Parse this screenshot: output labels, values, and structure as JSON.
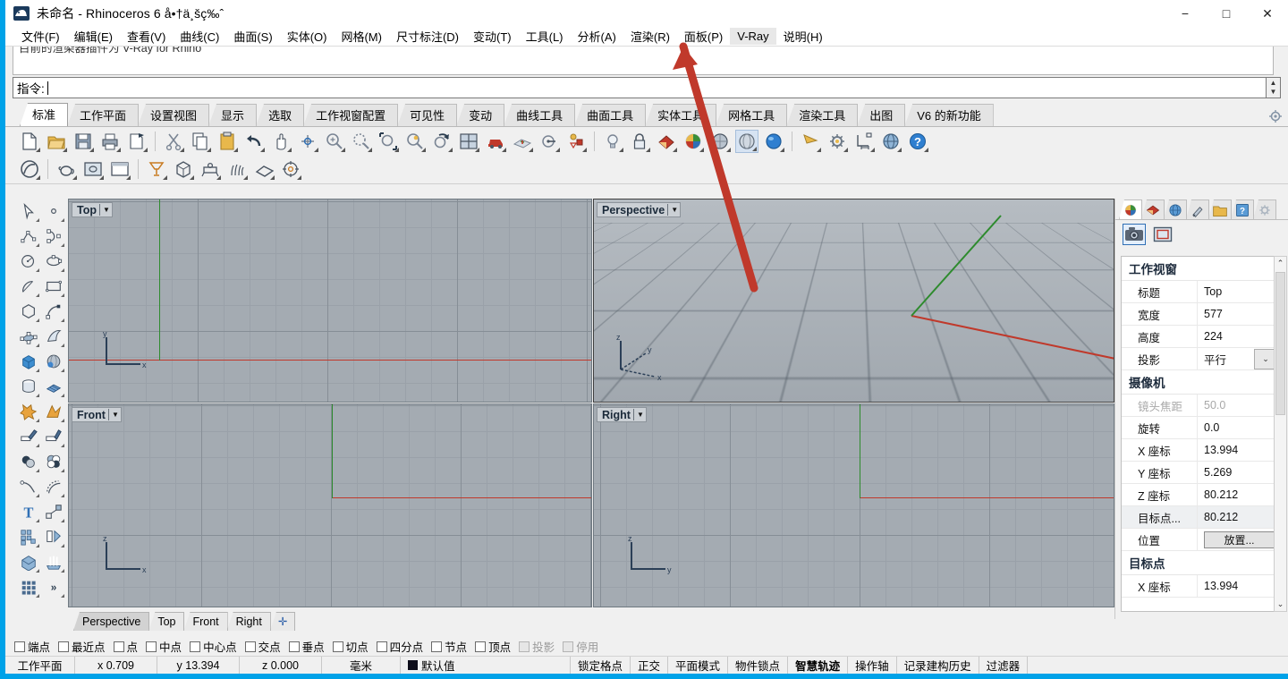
{
  "window": {
    "title": "未命名 - Rhinoceros 6 å•†ä¸šç‰ˆ",
    "app_icon": "rhino-icon",
    "minimize": "−",
    "maximize": "□",
    "close": "✕"
  },
  "menubar": {
    "items": [
      {
        "label": "文件(F)",
        "active": false
      },
      {
        "label": "编辑(E)",
        "active": false
      },
      {
        "label": "查看(V)",
        "active": false
      },
      {
        "label": "曲线(C)",
        "active": false
      },
      {
        "label": "曲面(S)",
        "active": false
      },
      {
        "label": "实体(O)",
        "active": false
      },
      {
        "label": "网格(M)",
        "active": false
      },
      {
        "label": "尺寸标注(D)",
        "active": false
      },
      {
        "label": "变动(T)",
        "active": false
      },
      {
        "label": "工具(L)",
        "active": false
      },
      {
        "label": "分析(A)",
        "active": false
      },
      {
        "label": "渲染(R)",
        "active": false
      },
      {
        "label": "面板(P)",
        "active": false
      },
      {
        "label": "V-Ray",
        "active": true
      },
      {
        "label": "说明(H)",
        "active": false
      }
    ]
  },
  "command": {
    "history_line": "目前的渲染器插件为 V-Ray for Rhino",
    "prompt_label": "指令:",
    "input_value": ""
  },
  "ribbon": {
    "tabs": [
      {
        "label": "标准",
        "selected": true
      },
      {
        "label": "工作平面",
        "selected": false
      },
      {
        "label": "设置视图",
        "selected": false
      },
      {
        "label": "显示",
        "selected": false
      },
      {
        "label": "选取",
        "selected": false
      },
      {
        "label": "工作视窗配置",
        "selected": false
      },
      {
        "label": "可见性",
        "selected": false
      },
      {
        "label": "变动",
        "selected": false
      },
      {
        "label": "曲线工具",
        "selected": false
      },
      {
        "label": "曲面工具",
        "selected": false
      },
      {
        "label": "实体工具",
        "selected": false
      },
      {
        "label": "网格工具",
        "selected": false
      },
      {
        "label": "渲染工具",
        "selected": false
      },
      {
        "label": "出图",
        "selected": false
      },
      {
        "label": "V6 的新功能",
        "selected": false
      }
    ],
    "options_icon": "gear-icon"
  },
  "toolbar_row1": [
    {
      "name": "new-file-icon"
    },
    {
      "name": "open-file-icon"
    },
    {
      "name": "save-icon"
    },
    {
      "name": "print-icon"
    },
    {
      "name": "save-as-image-icon"
    },
    {
      "sep": true
    },
    {
      "name": "cut-icon"
    },
    {
      "name": "copy-icon"
    },
    {
      "name": "paste-icon"
    },
    {
      "name": "undo-icon"
    },
    {
      "name": "pan-icon"
    },
    {
      "name": "rotate-view-icon"
    },
    {
      "name": "zoom-icon"
    },
    {
      "name": "zoom-dynamic-icon"
    },
    {
      "name": "zoom-window-icon"
    },
    {
      "name": "zoom-selected-icon"
    },
    {
      "name": "zoom-extents-icon"
    },
    {
      "name": "four-viewport-icon"
    },
    {
      "name": "render-preview-icon"
    },
    {
      "name": "cplane-icon"
    },
    {
      "name": "named-view-icon"
    },
    {
      "name": "layer-icon"
    },
    {
      "sep": true
    },
    {
      "name": "light-icon"
    },
    {
      "name": "lock-icon"
    },
    {
      "name": "material-icon"
    },
    {
      "name": "render-color-icon"
    },
    {
      "name": "shade-icon"
    },
    {
      "name": "ghosted-icon"
    },
    {
      "name": "render-icon"
    },
    {
      "sep": true
    },
    {
      "name": "spray-icon"
    },
    {
      "name": "options-gear-icon"
    },
    {
      "name": "dimension-icon"
    },
    {
      "name": "web-help-icon"
    },
    {
      "name": "help-icon"
    }
  ],
  "toolbar_row2": [
    {
      "name": "rhino-logo-icon"
    },
    {
      "sep": true
    },
    {
      "name": "teapot-icon"
    },
    {
      "name": "render-window-icon"
    },
    {
      "name": "frame-buffer-icon"
    },
    {
      "sep": true
    },
    {
      "name": "vray-light-icon"
    },
    {
      "name": "vray-object-icon"
    },
    {
      "name": "vray-proxy-icon"
    },
    {
      "name": "vray-fur-icon"
    },
    {
      "name": "vray-plane-icon"
    },
    {
      "name": "vray-target-icon"
    }
  ],
  "left_toolbar": [
    {
      "name": "select-arrow-icon"
    },
    {
      "name": "point-icon"
    },
    {
      "name": "polyline-icon"
    },
    {
      "name": "curve-interp-icon"
    },
    {
      "name": "circle-icon"
    },
    {
      "name": "ellipse-icon"
    },
    {
      "name": "arc-icon"
    },
    {
      "name": "rectangle-icon"
    },
    {
      "name": "polygon-icon"
    },
    {
      "name": "curve-control-icon"
    },
    {
      "name": "surface-pts-icon"
    },
    {
      "name": "surface-loft-icon"
    },
    {
      "name": "box-icon"
    },
    {
      "name": "sphere-icon"
    },
    {
      "name": "cylinder-icon"
    },
    {
      "name": "mesh-icon"
    },
    {
      "name": "boolean-union-icon"
    },
    {
      "name": "explode-icon"
    },
    {
      "name": "trim-icon"
    },
    {
      "name": "split-icon"
    },
    {
      "name": "boolean-diff-icon"
    },
    {
      "name": "boolean-inter-icon"
    },
    {
      "name": "fillet-icon"
    },
    {
      "name": "offset-curve-icon"
    },
    {
      "name": "text-icon"
    },
    {
      "name": "scale-icon"
    },
    {
      "name": "array-icon"
    },
    {
      "name": "mirror-icon"
    },
    {
      "name": "extrude-icon"
    },
    {
      "name": "loft-icon"
    },
    {
      "name": "grid-array-icon"
    },
    {
      "name": "more-tools-icon"
    }
  ],
  "viewports": [
    {
      "id": "top",
      "label": "Top",
      "active": false
    },
    {
      "id": "perspective",
      "label": "Perspective",
      "active": true
    },
    {
      "id": "front",
      "label": "Front",
      "active": false
    },
    {
      "id": "right",
      "label": "Right",
      "active": false
    }
  ],
  "viewport_tabs": [
    {
      "label": "Perspective",
      "selected": true
    },
    {
      "label": "Top",
      "selected": false
    },
    {
      "label": "Front",
      "selected": false
    },
    {
      "label": "Right",
      "selected": false
    },
    {
      "label": "✛",
      "selected": false
    }
  ],
  "properties_panel": {
    "tab_icons": [
      {
        "name": "properties-icon",
        "selected": true
      },
      {
        "name": "layer-panel-icon",
        "selected": false
      },
      {
        "name": "environment-icon",
        "selected": false
      },
      {
        "name": "material-brush-icon",
        "selected": false
      },
      {
        "name": "folder-icon",
        "selected": false
      },
      {
        "name": "help-panel-icon",
        "selected": false
      },
      {
        "name": "panel-gear-icon",
        "selected": false
      }
    ],
    "sub_icons": [
      {
        "name": "camera-icon",
        "selected": true
      },
      {
        "name": "viewport-frame-icon",
        "selected": false
      }
    ],
    "sections": [
      {
        "title": "工作视窗",
        "rows": [
          {
            "key": "标题",
            "value": "Top",
            "kind": "text"
          },
          {
            "key": "宽度",
            "value": "577",
            "kind": "text"
          },
          {
            "key": "高度",
            "value": "224",
            "kind": "text"
          },
          {
            "key": "投影",
            "value": "平行",
            "kind": "combo"
          }
        ]
      },
      {
        "title": "摄像机",
        "rows": [
          {
            "key": "镜头焦距",
            "value": "50.0",
            "kind": "text",
            "disabled": true
          },
          {
            "key": "旋转",
            "value": "0.0",
            "kind": "text"
          },
          {
            "key": "X 座标",
            "value": "13.994",
            "kind": "text"
          },
          {
            "key": "Y 座标",
            "value": "5.269",
            "kind": "text"
          },
          {
            "key": "Z 座标",
            "value": "80.212",
            "kind": "text"
          },
          {
            "key": "目标点...",
            "value": "80.212",
            "kind": "text",
            "shaded": true
          },
          {
            "key": "位置",
            "value": "放置...",
            "kind": "button"
          }
        ]
      },
      {
        "title": "目标点",
        "rows": [
          {
            "key": "X 座标",
            "value": "13.994",
            "kind": "text"
          }
        ]
      }
    ]
  },
  "osnap": {
    "items": [
      {
        "label": "端点",
        "checked": false,
        "disabled": false
      },
      {
        "label": "最近点",
        "checked": false,
        "disabled": false
      },
      {
        "label": "点",
        "checked": false,
        "disabled": false
      },
      {
        "label": "中点",
        "checked": false,
        "disabled": false
      },
      {
        "label": "中心点",
        "checked": false,
        "disabled": false
      },
      {
        "label": "交点",
        "checked": false,
        "disabled": false
      },
      {
        "label": "垂点",
        "checked": false,
        "disabled": false
      },
      {
        "label": "切点",
        "checked": false,
        "disabled": false
      },
      {
        "label": "四分点",
        "checked": false,
        "disabled": false
      },
      {
        "label": "节点",
        "checked": false,
        "disabled": false
      },
      {
        "label": "顶点",
        "checked": false,
        "disabled": false
      },
      {
        "label": "投影",
        "checked": false,
        "disabled": true
      },
      {
        "label": "停用",
        "checked": false,
        "disabled": true
      }
    ]
  },
  "statusbar": {
    "cplane_label": "工作平面",
    "x": "x 0.709",
    "y": "y 13.394",
    "z": "z 0.000",
    "units": "毫米",
    "layer": "默认值",
    "layer_color": "#0d0d1a",
    "toggles": [
      {
        "label": "锁定格点",
        "bold": false
      },
      {
        "label": "正交",
        "bold": false
      },
      {
        "label": "平面模式",
        "bold": false
      },
      {
        "label": "物件锁点",
        "bold": false
      },
      {
        "label": "智慧轨迹",
        "bold": true
      },
      {
        "label": "操作轴",
        "bold": false
      },
      {
        "label": "记录建构历史",
        "bold": false
      },
      {
        "label": "过滤器",
        "bold": false
      }
    ]
  },
  "annotation": {
    "name": "red-arrow-pointing-to-vray-menu",
    "color": "#c0392b"
  }
}
